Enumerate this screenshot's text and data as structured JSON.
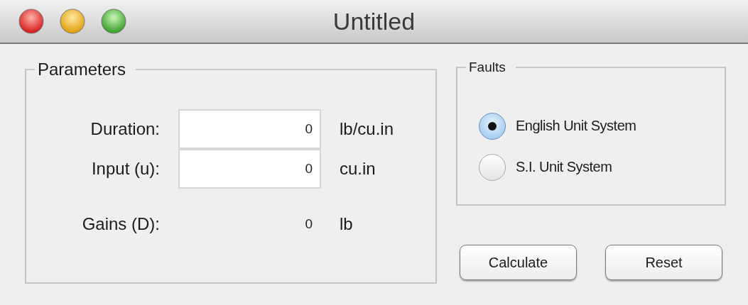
{
  "window": {
    "title": "Untitled"
  },
  "parameters": {
    "title": "Parameters",
    "rows": [
      {
        "kind": "input",
        "label": "Duration:",
        "value": "0",
        "unit": "lb/cu.in"
      },
      {
        "kind": "input",
        "label": "Input (u):",
        "value": "0",
        "unit": "cu.in"
      },
      {
        "kind": "output",
        "label": "Gains (D):",
        "value": "0",
        "unit": "lb"
      }
    ]
  },
  "faults": {
    "title": "Faults",
    "options": [
      {
        "label": "English Unit System",
        "selected": true
      },
      {
        "label": "S.I. Unit System",
        "selected": false
      }
    ]
  },
  "buttons": [
    "Calculate",
    "Reset"
  ]
}
